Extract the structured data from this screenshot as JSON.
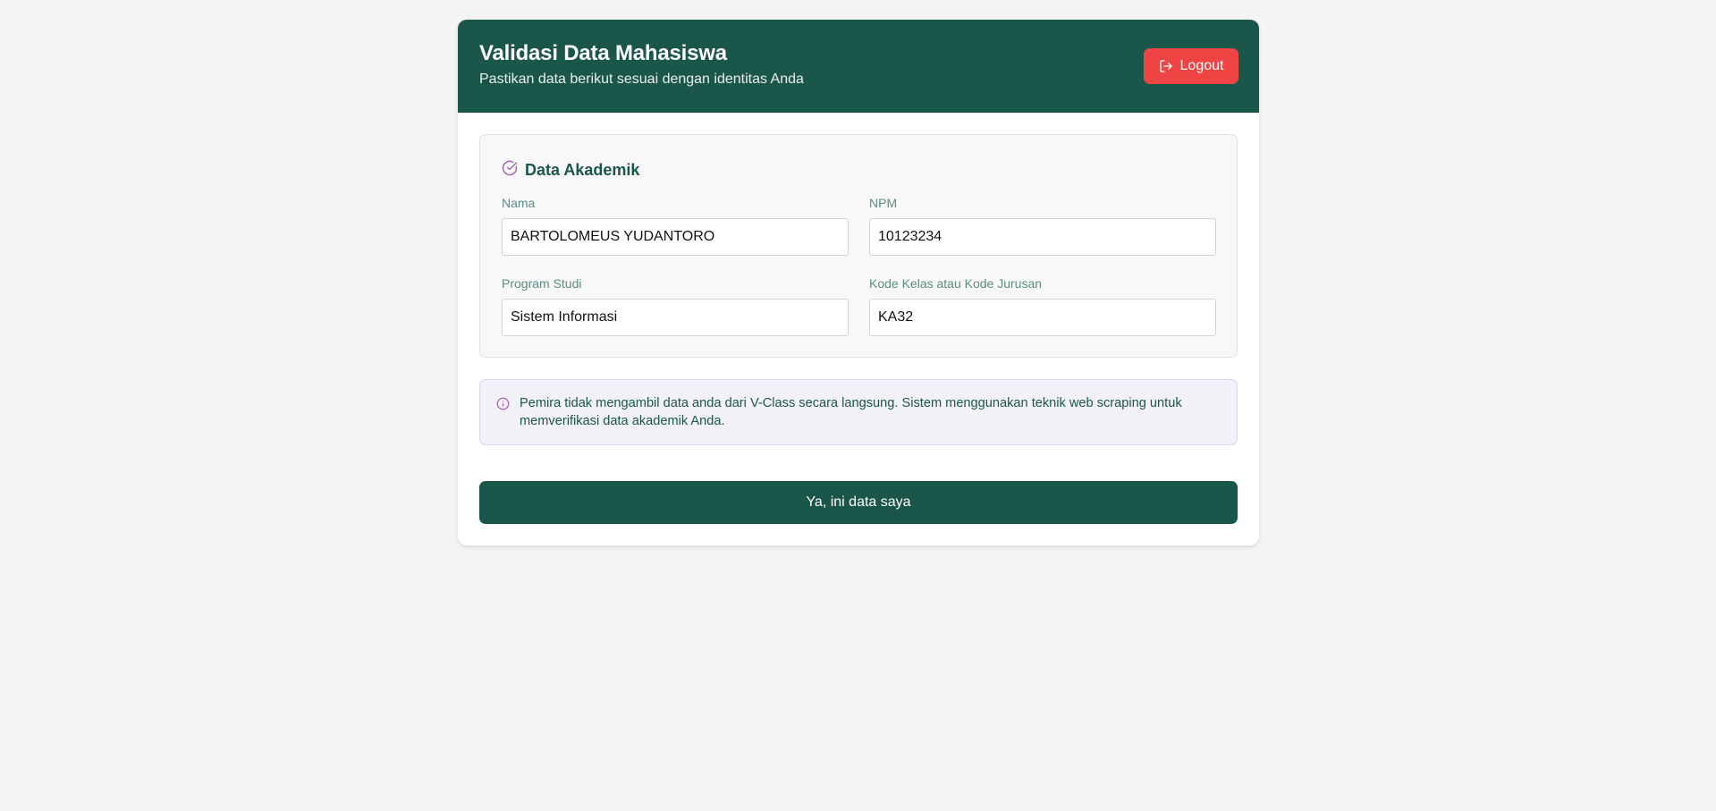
{
  "header": {
    "title": "Validasi Data Mahasiswa",
    "subtitle": "Pastikan data berikut sesuai dengan identitas Anda",
    "logout_label": "Logout",
    "logout_icon": "logout-icon"
  },
  "academic": {
    "title": "Data Akademik",
    "title_icon": "check-circle-icon",
    "fields": {
      "name": {
        "label": "Nama",
        "value": "BARTOLOMEUS YUDANTORO"
      },
      "npm": {
        "label": "NPM",
        "value": "10123234"
      },
      "program": {
        "label": "Program Studi",
        "value": "Sistem Informasi"
      },
      "class_code": {
        "label": "Kode Kelas atau Kode Jurusan",
        "value": "KA32"
      }
    }
  },
  "notice": {
    "icon": "info-icon",
    "text": "Pemira tidak mengambil data anda dari V-Class secara langsung. Sistem menggunakan teknik web scraping untuk memverifikasi data akademik Anda."
  },
  "confirm": {
    "label": "Ya, ini data saya"
  },
  "colors": {
    "primary": "#1b564b",
    "danger": "#ef4444",
    "accent_icon": "#a668b3",
    "page_background": "#f4f4f4"
  }
}
